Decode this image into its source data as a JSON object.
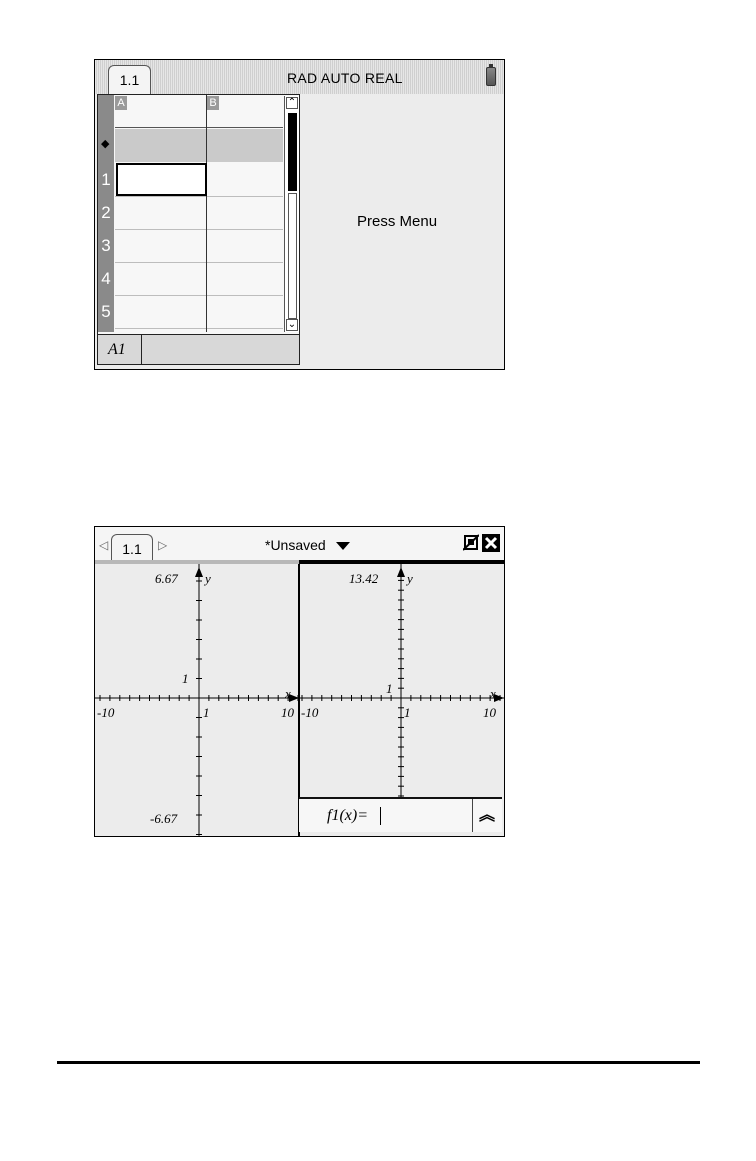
{
  "screen1": {
    "tab_label": "1.1",
    "status": "RAD AUTO REAL",
    "battery_icon": "battery-icon",
    "columns": [
      "A",
      "B"
    ],
    "row_labels": [
      "1",
      "2",
      "3",
      "4",
      "5"
    ],
    "formula_row_marker": "◆",
    "cell_reference": "A1",
    "message": "Press Menu"
  },
  "screen2": {
    "tab_label": "1.1",
    "nav_prev": "◁",
    "nav_next": "▷",
    "document_title": "*Unsaved",
    "left_graph": {
      "ymax_label": "6.67",
      "ymin_label": "-6.67",
      "y_label": "y",
      "x_label": "x",
      "xmin_label": "-10",
      "xmax_label": "10",
      "x_tick_label": "1",
      "y_tick_label": "1"
    },
    "right_graph": {
      "ymax_label": "13.42",
      "y_label": "y",
      "x_label": "x",
      "xmin_label": "-10",
      "xmax_label": "10",
      "x_tick_label": "1",
      "y_tick_label": "1"
    },
    "entry_line": "f1(x)="
  }
}
